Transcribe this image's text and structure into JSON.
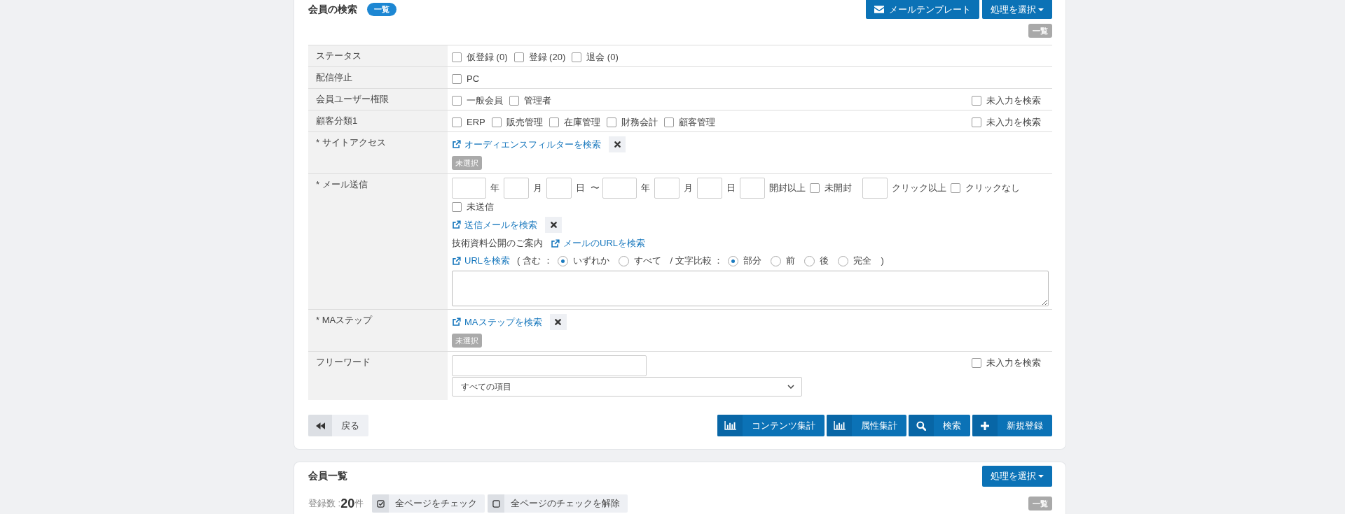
{
  "search_panel": {
    "title": "会員の検索",
    "title_badge": "一覧",
    "header_buttons": [
      {
        "kind": "mail",
        "label": "メールテンプレート"
      },
      {
        "kind": "menu",
        "label": "処理を選択"
      }
    ],
    "view_badge": "一覧",
    "rows": [
      {
        "kind": "checkboxes",
        "label": "ステータス",
        "options": [
          {
            "label": "仮登録 (0)",
            "checked": false
          },
          {
            "label": "登録 (20)",
            "checked": false
          },
          {
            "label": "退会 (0)",
            "checked": false
          }
        ]
      },
      {
        "kind": "checkboxes",
        "label": "配信停止",
        "options": [
          {
            "label": "PC",
            "checked": false
          }
        ]
      },
      {
        "kind": "checkboxes",
        "label": "会員ユーザー権限",
        "options": [
          {
            "label": "一般会員",
            "checked": false
          },
          {
            "label": "管理者",
            "checked": false
          }
        ],
        "empty_search": {
          "label": "未入力を検索",
          "checked": false
        }
      },
      {
        "kind": "checkboxes",
        "label": "顧客分類1",
        "options": [
          {
            "label": "ERP",
            "checked": false
          },
          {
            "label": "販売管理",
            "checked": false
          },
          {
            "label": "在庫管理",
            "checked": false
          },
          {
            "label": "財務会計",
            "checked": false
          },
          {
            "label": "顧客管理",
            "checked": false
          }
        ],
        "empty_search": {
          "label": "未入力を検索",
          "checked": false
        }
      },
      {
        "kind": "filter",
        "label": "* サイトアクセス",
        "link": "オーディエンスフィルターを検索",
        "tag": "未選択"
      },
      {
        "kind": "mail",
        "label": "* メール送信",
        "fields": [
          {
            "kind": "year",
            "unit": "年"
          },
          {
            "kind": "short",
            "unit": "月"
          },
          {
            "kind": "short",
            "unit": "日"
          },
          {
            "kind": "separator",
            "text": "〜"
          },
          {
            "kind": "year",
            "unit": "年"
          },
          {
            "kind": "short",
            "unit": "月"
          },
          {
            "kind": "short",
            "unit": "日"
          },
          {
            "kind": "short",
            "unit": "開封以上"
          },
          {
            "kind": "checkbox",
            "label": "未開封",
            "checked": false
          },
          {
            "kind": "short",
            "unit": "クリック以上"
          },
          {
            "kind": "checkbox",
            "label": "クリックなし",
            "checked": false
          }
        ],
        "unsent": {
          "label": "未送信",
          "checked": false
        },
        "link": "送信メールを検索",
        "selected_mail": "技術資料公開のご案内",
        "mail_url_link": "メールのURLを検索",
        "url_link": "URLを検索",
        "contains_label": "( 含む ：",
        "contains_options": [
          {
            "label": "いずれか",
            "selected": true
          },
          {
            "label": "すべて",
            "selected": false
          }
        ],
        "compare_label": "/ 文字比較 ：",
        "compare_options": [
          {
            "label": "部分",
            "selected": true
          },
          {
            "label": "前",
            "selected": false
          },
          {
            "label": "後",
            "selected": false
          },
          {
            "label": "完全",
            "selected": false
          }
        ],
        "closing": ")"
      },
      {
        "kind": "filter",
        "label": "* MAステップ",
        "link": "MAステップを検索",
        "tag": "未選択"
      },
      {
        "kind": "freeword",
        "label": "フリーワード",
        "select": "すべての項目",
        "empty_search": {
          "label": "未入力を検索",
          "checked": false
        }
      }
    ],
    "back_button": {
      "label": "戻る"
    },
    "actions": [
      {
        "kind": "chart",
        "label": "コンテンツ集計"
      },
      {
        "kind": "chart",
        "label": "属性集計"
      },
      {
        "kind": "search",
        "label": "検索"
      },
      {
        "kind": "add",
        "label": "新規登録"
      }
    ]
  },
  "member_list": {
    "title": "会員一覧",
    "action_button": "処理を選択",
    "view_badge": "一覧",
    "count_label": "登録数 :",
    "count": "20",
    "count_unit": "件",
    "buttons": [
      {
        "kind": "check_all",
        "label": "全ページをチェック"
      },
      {
        "kind": "uncheck_all",
        "label": "全ページのチェックを解除"
      }
    ]
  }
}
